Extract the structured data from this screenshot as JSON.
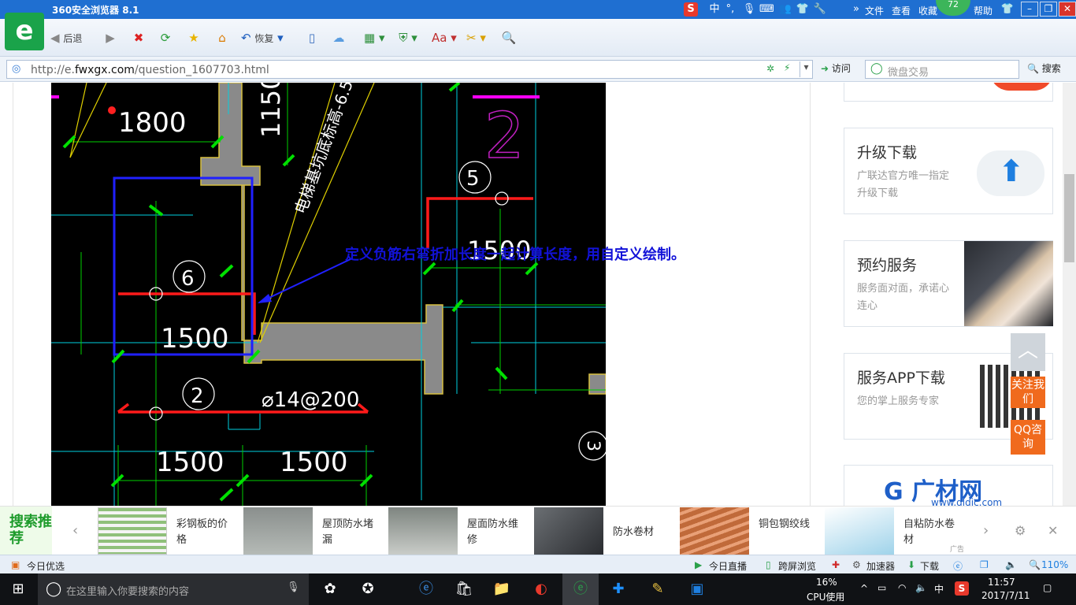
{
  "window": {
    "title": "360安全浏览器 8.1",
    "menu": [
      "文件",
      "查看",
      "收藏",
      "帮助"
    ],
    "badge_count": "72",
    "ime_label": "中"
  },
  "toolbar": {
    "back_label": "后退",
    "restore_label": "恢复"
  },
  "address": {
    "url_prefix": "http://e.",
    "url_domain": "fwxgx.com",
    "url_path": "/question_1607703.html",
    "visit_label": "访问",
    "search_placeholder": "微盘交易",
    "search_button": "搜索"
  },
  "cad": {
    "annotation": "定义负筋右弯折加长度一起计算长度，用自定义绘制。",
    "dims": [
      "1800",
      "1150",
      "1500",
      "1500",
      "1500",
      "1500"
    ],
    "axis_labels": [
      "2",
      "5",
      "6",
      "2",
      "3"
    ],
    "rebar_label": "⌀14@200",
    "slope_label": "电梯基坑底标高-6.5"
  },
  "sidebar": {
    "cards": [
      {
        "title": "升级下载",
        "desc": "广联达官方唯一指定升级下载"
      },
      {
        "title": "预约服务",
        "desc": "服务面对面，承诺心连心"
      },
      {
        "title": "服务APP下载",
        "desc": "您的掌上服务专家"
      }
    ],
    "brand": "广材网",
    "brand_url": "www.gldjc.com",
    "follow_label": "关注我们",
    "qq_label": "QQ咨询"
  },
  "recommend": {
    "head": "搜索推荐",
    "items": [
      "彩钢板的价格",
      "屋顶防水堵漏",
      "屋面防水维修",
      "防水卷材",
      "铜包钢绞线",
      "自粘防水卷材"
    ],
    "ad_label": "广告"
  },
  "status": {
    "left": "今日优选",
    "items": [
      "今日直播",
      "跨屏浏览",
      "加速器",
      "下载"
    ],
    "zoom": "110%"
  },
  "taskbar": {
    "search_placeholder": "在这里输入你要搜索的内容",
    "cpu_percent": "16%",
    "cpu_label": "CPU使用",
    "ime": "中",
    "time": "11:57",
    "date": "2017/7/11"
  },
  "colors": {
    "titlebar": "#1f6fd1",
    "cad_bg": "#000000",
    "annotation": "#1212d8",
    "sidebar_orange": "#f06a1d"
  }
}
